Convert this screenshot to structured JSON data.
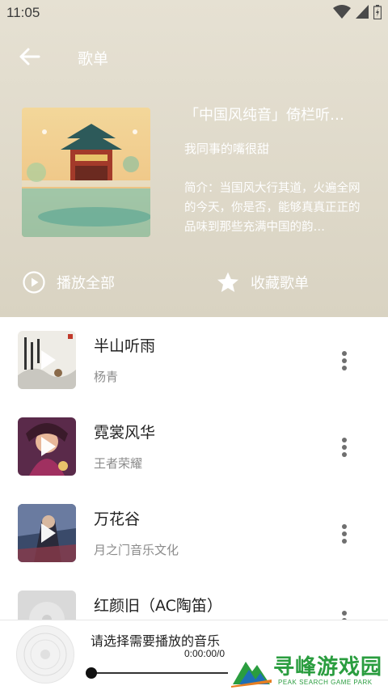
{
  "status": {
    "time": "11:05"
  },
  "header": {
    "title": "歌单"
  },
  "playlist": {
    "title": "「中国风纯音」倚栏听…",
    "creator": "我同事的嘴很甜",
    "description": "简介：当国风大行其道，火遍全网的今天，你是否，能够真真正正的品味到那些充满中国的韵…",
    "play_all_label": "播放全部",
    "favorite_label": "收藏歌单"
  },
  "songs": [
    {
      "name": "半山听雨",
      "artist": "杨青"
    },
    {
      "name": "霓裳风华",
      "artist": "王者荣耀"
    },
    {
      "name": "万花谷",
      "artist": "月之门音乐文化"
    },
    {
      "name": "红颜旧（AC陶笛）",
      "artist": ""
    }
  ],
  "player": {
    "title": "请选择需要播放的音乐",
    "time": "0:00:00/0",
    "progress": 0
  },
  "watermark": {
    "text": "寻峰游戏园",
    "subtext": "PEAK SEARCH GAME PARK"
  },
  "colors": {
    "hero_bg": "#e0dacb",
    "accent_text": "#ffffff",
    "watermark": "#2a9d3f"
  }
}
